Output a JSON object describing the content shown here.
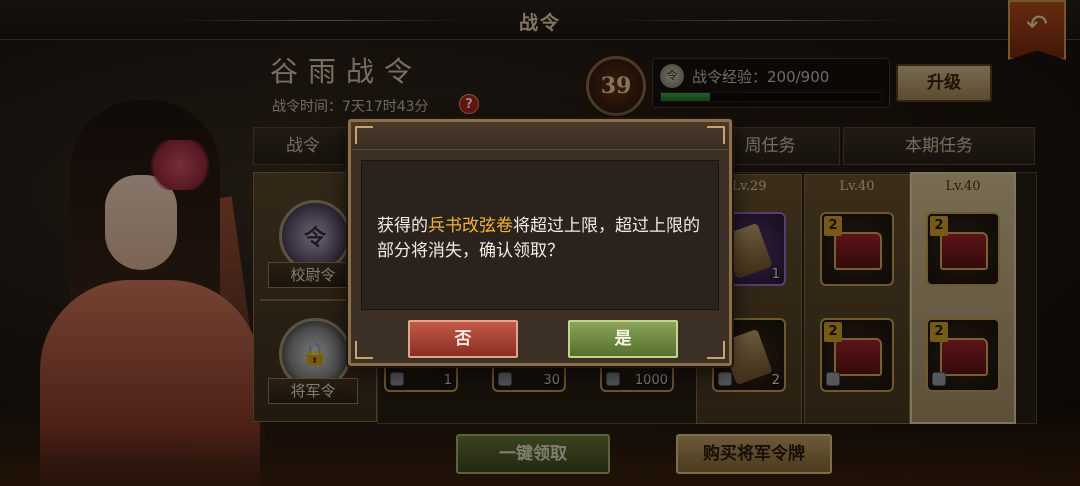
{
  "header": {
    "title": "战令",
    "back_icon": "back-arrow-icon"
  },
  "season": {
    "title": "谷雨战令",
    "time_label": "战令时间：7天17时43分",
    "help_icon": "?"
  },
  "progress": {
    "level": "39",
    "exp_icon": "令",
    "exp_label": "战令经验：200/900",
    "exp_current": 200,
    "exp_max": 900,
    "upgrade_label": "升级"
  },
  "tabs": [
    {
      "label": "战令"
    },
    {
      "label": "周任务"
    },
    {
      "label": "本期任务"
    }
  ],
  "categories": [
    {
      "label": "校尉令",
      "icon": "令"
    },
    {
      "label": "将军令",
      "icon": "lock-icon"
    }
  ],
  "reward_columns": [
    {
      "level_label": "Lv.29",
      "top_count": "1",
      "bottom_count": "2"
    },
    {
      "level_label": "Lv.40",
      "top_badge": "2",
      "bottom_badge": "2"
    },
    {
      "level_label": "Lv.40",
      "top_badge": "2",
      "bottom_badge": "2"
    }
  ],
  "bottom_counts": [
    "1",
    "30",
    "1000"
  ],
  "buttons": {
    "claim_all": "一键领取",
    "buy_token": "购买将军令牌"
  },
  "dialog": {
    "msg_prefix": "获得的",
    "msg_item": "兵书改弦卷",
    "msg_suffix": "将超过上限，超过上限的部分将消失，确认领取？",
    "no_label": "否",
    "yes_label": "是"
  },
  "colors": {
    "highlight_text": "#f2b23a",
    "exp_fill": "#3cae4c",
    "no_button": "#c25a48",
    "yes_button": "#8aa45a"
  }
}
